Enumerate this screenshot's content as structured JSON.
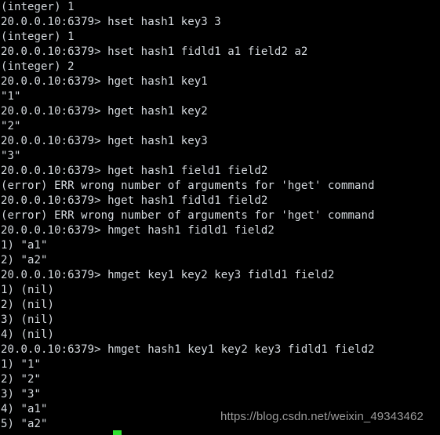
{
  "terminal": {
    "app": "redis-cli",
    "background_color": "#000000",
    "text_color": "#d6dbe0",
    "cursor_color": "#2fe02f",
    "prompt_prefix": "20.0.0.10:6379> ",
    "lines": [
      {
        "type": "output",
        "text": "(integer) 1"
      },
      {
        "type": "prompt",
        "text": "20.0.0.10:6379> hset hash1 key3 3"
      },
      {
        "type": "output",
        "text": "(integer) 1"
      },
      {
        "type": "prompt",
        "text": "20.0.0.10:6379> hset hash1 fidld1 a1 field2 a2"
      },
      {
        "type": "output",
        "text": "(integer) 2"
      },
      {
        "type": "prompt",
        "text": "20.0.0.10:6379> hget hash1 key1"
      },
      {
        "type": "output",
        "text": "\"1\""
      },
      {
        "type": "prompt",
        "text": "20.0.0.10:6379> hget hash1 key2"
      },
      {
        "type": "output",
        "text": "\"2\""
      },
      {
        "type": "prompt",
        "text": "20.0.0.10:6379> hget hash1 key3"
      },
      {
        "type": "output",
        "text": "\"3\""
      },
      {
        "type": "prompt",
        "text": "20.0.0.10:6379> hget hash1 field1 field2"
      },
      {
        "type": "error",
        "text": "(error) ERR wrong number of arguments for 'hget' command"
      },
      {
        "type": "prompt",
        "text": "20.0.0.10:6379> hget hash1 fidld1 field2"
      },
      {
        "type": "error",
        "text": "(error) ERR wrong number of arguments for 'hget' command"
      },
      {
        "type": "prompt",
        "text": "20.0.0.10:6379> hmget hash1 fidld1 field2"
      },
      {
        "type": "output",
        "text": "1) \"a1\""
      },
      {
        "type": "output",
        "text": "2) \"a2\""
      },
      {
        "type": "prompt",
        "text": "20.0.0.10:6379> hmget key1 key2 key3 fidld1 field2"
      },
      {
        "type": "output",
        "text": "1) (nil)"
      },
      {
        "type": "output",
        "text": "2) (nil)"
      },
      {
        "type": "output",
        "text": "3) (nil)"
      },
      {
        "type": "output",
        "text": "4) (nil)"
      },
      {
        "type": "prompt",
        "text": "20.0.0.10:6379> hmget hash1 key1 key2 key3 fidld1 field2"
      },
      {
        "type": "output",
        "text": "1) \"1\""
      },
      {
        "type": "output",
        "text": "2) \"2\""
      },
      {
        "type": "output",
        "text": "3) \"3\""
      },
      {
        "type": "output",
        "text": "4) \"a1\""
      },
      {
        "type": "output",
        "text": "5) \"a2\""
      }
    ]
  },
  "watermark": {
    "text": "https://blog.csdn.net/weixin_49343462",
    "color": "#9b9b9b"
  }
}
